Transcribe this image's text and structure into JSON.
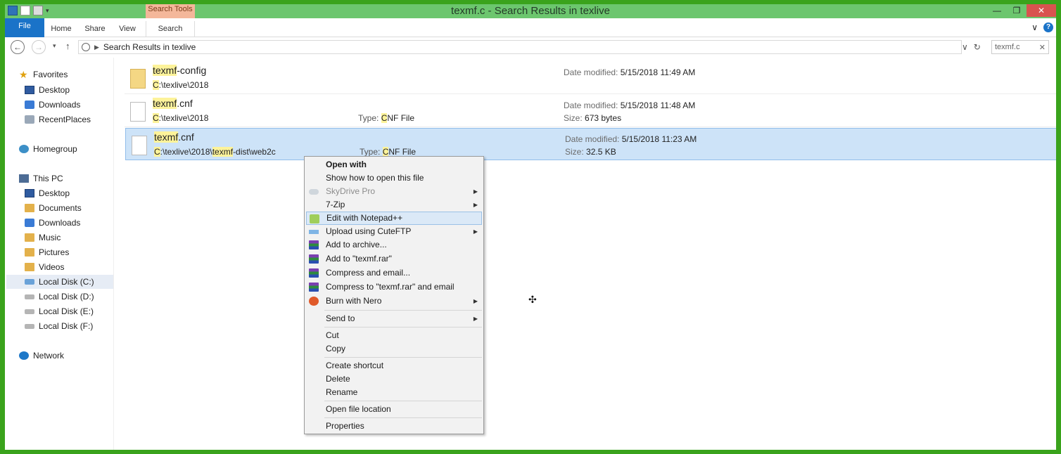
{
  "window": {
    "title": "texmf.c - Search Results in texlive",
    "context_tab": "Search Tools",
    "min_glyph": "—",
    "max_glyph": "❐",
    "close_glyph": "✕"
  },
  "ribbon": {
    "tabs": [
      "File",
      "Home",
      "Share",
      "View",
      "Search"
    ],
    "collapse_glyph": "∨",
    "help_glyph": "?"
  },
  "address": {
    "back_glyph": "←",
    "forward_glyph": "→",
    "recent_glyph": "▾",
    "up_glyph": "↑",
    "breadcrumb": "Search Results in texlive",
    "dropdown_glyph": "∨",
    "refresh_glyph": "↻",
    "search_value": "texmf.c",
    "search_clear": "✕"
  },
  "nav": {
    "favorites": "Favorites",
    "desktop": "Desktop",
    "downloads": "Downloads",
    "recent_places": "RecentPlaces",
    "homegroup": "Homegroup",
    "this_pc": "This PC",
    "pc_desktop": "Desktop",
    "documents": "Documents",
    "pc_downloads": "Downloads",
    "music": "Music",
    "pictures": "Pictures",
    "videos": "Videos",
    "disk_c": "Local Disk (C:)",
    "disk_d": "Local Disk (D:)",
    "disk_e": "Local Disk (E:)",
    "disk_f": "Local Disk (F:)",
    "network": "Network"
  },
  "results": [
    {
      "name_hl": "texmf",
      "name_rest": "-config",
      "path_hl": "C",
      "path_rest": ":\\texlive\\2018",
      "date_label": "Date modified:",
      "date": "5/15/2018 11:49 AM"
    },
    {
      "name_hl": "texmf",
      "name_rest": ".cnf",
      "path_hl": "C",
      "path_rest": ":\\texlive\\2018",
      "type_label": "Type: ",
      "type_hl": "C",
      "type_rest": "NF File",
      "date_label": "Date modified:",
      "date": "5/15/2018 11:48 AM",
      "size_label": "Size:",
      "size": "673 bytes"
    },
    {
      "name_hl": "texmf",
      "name_rest": ".cnf",
      "path_hl": "C",
      "path_mid": ":\\texlive\\2018\\",
      "path_hl2": "texmf",
      "path_rest": "-dist\\web2c",
      "type_label": "Type: ",
      "type_hl": "C",
      "type_rest": "NF File",
      "date_label": "Date modified:",
      "date": "5/15/2018 11:23 AM",
      "size_label": "Size:",
      "size": "32.5 KB"
    }
  ],
  "context_menu": {
    "open_with": "Open with",
    "show_how": "Show how to open this file",
    "skydrive": "SkyDrive Pro",
    "seven_zip": "7-Zip",
    "notepadpp": "Edit with Notepad++",
    "cuteftp": "Upload using CuteFTP",
    "add_archive": "Add to archive...",
    "add_rar": "Add to \"texmf.rar\"",
    "compress_email": "Compress and email...",
    "compress_rar_email": "Compress to \"texmf.rar\" and email",
    "nero": "Burn with Nero",
    "send_to": "Send to",
    "cut": "Cut",
    "copy": "Copy",
    "create_shortcut": "Create shortcut",
    "delete": "Delete",
    "rename": "Rename",
    "open_location": "Open file location",
    "properties": "Properties",
    "arrow": "▶"
  },
  "cursor_glyph": "✣",
  "colors": {
    "title_bar": "#6cc66e",
    "outer_border": "#3aa31c",
    "selection": "#cde3f8",
    "highlight": "#fdf39a",
    "file_tab": "#1a73c8"
  }
}
